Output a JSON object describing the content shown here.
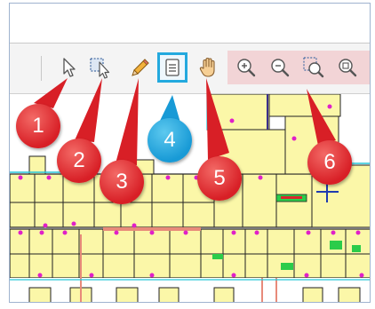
{
  "toolbar": {
    "tools": [
      {
        "icon": "arrow-cursor-icon",
        "state": "normal"
      },
      {
        "icon": "box-select-icon",
        "state": "normal"
      },
      {
        "icon": "pencil-icon",
        "state": "normal"
      },
      {
        "icon": "document-icon",
        "state": "selected"
      },
      {
        "icon": "hand-pan-icon",
        "state": "normal"
      },
      {
        "icon": "zoom-in-icon",
        "state": "normal"
      },
      {
        "icon": "zoom-out-icon",
        "state": "normal"
      },
      {
        "icon": "zoom-window-icon",
        "state": "normal"
      },
      {
        "icon": "zoom-extents-icon",
        "state": "normal"
      }
    ],
    "selected_color": "#23a9de",
    "zoom_group_color": "#f2d4d6"
  },
  "callouts": [
    {
      "label": "1",
      "color": "red"
    },
    {
      "label": "2",
      "color": "red"
    },
    {
      "label": "3",
      "color": "red"
    },
    {
      "label": "4",
      "color": "blue"
    },
    {
      "label": "5",
      "color": "red"
    },
    {
      "label": "6",
      "color": "red"
    }
  ],
  "colors": {
    "callout_red": "#d81f26",
    "callout_blue": "#189ad6",
    "floorplan_fill": "#fbf7a8",
    "wall": "#222222",
    "door_magenta": "#e020c8",
    "accent_green": "#2bcc4a",
    "accent_cyan": "#26c6d8"
  }
}
